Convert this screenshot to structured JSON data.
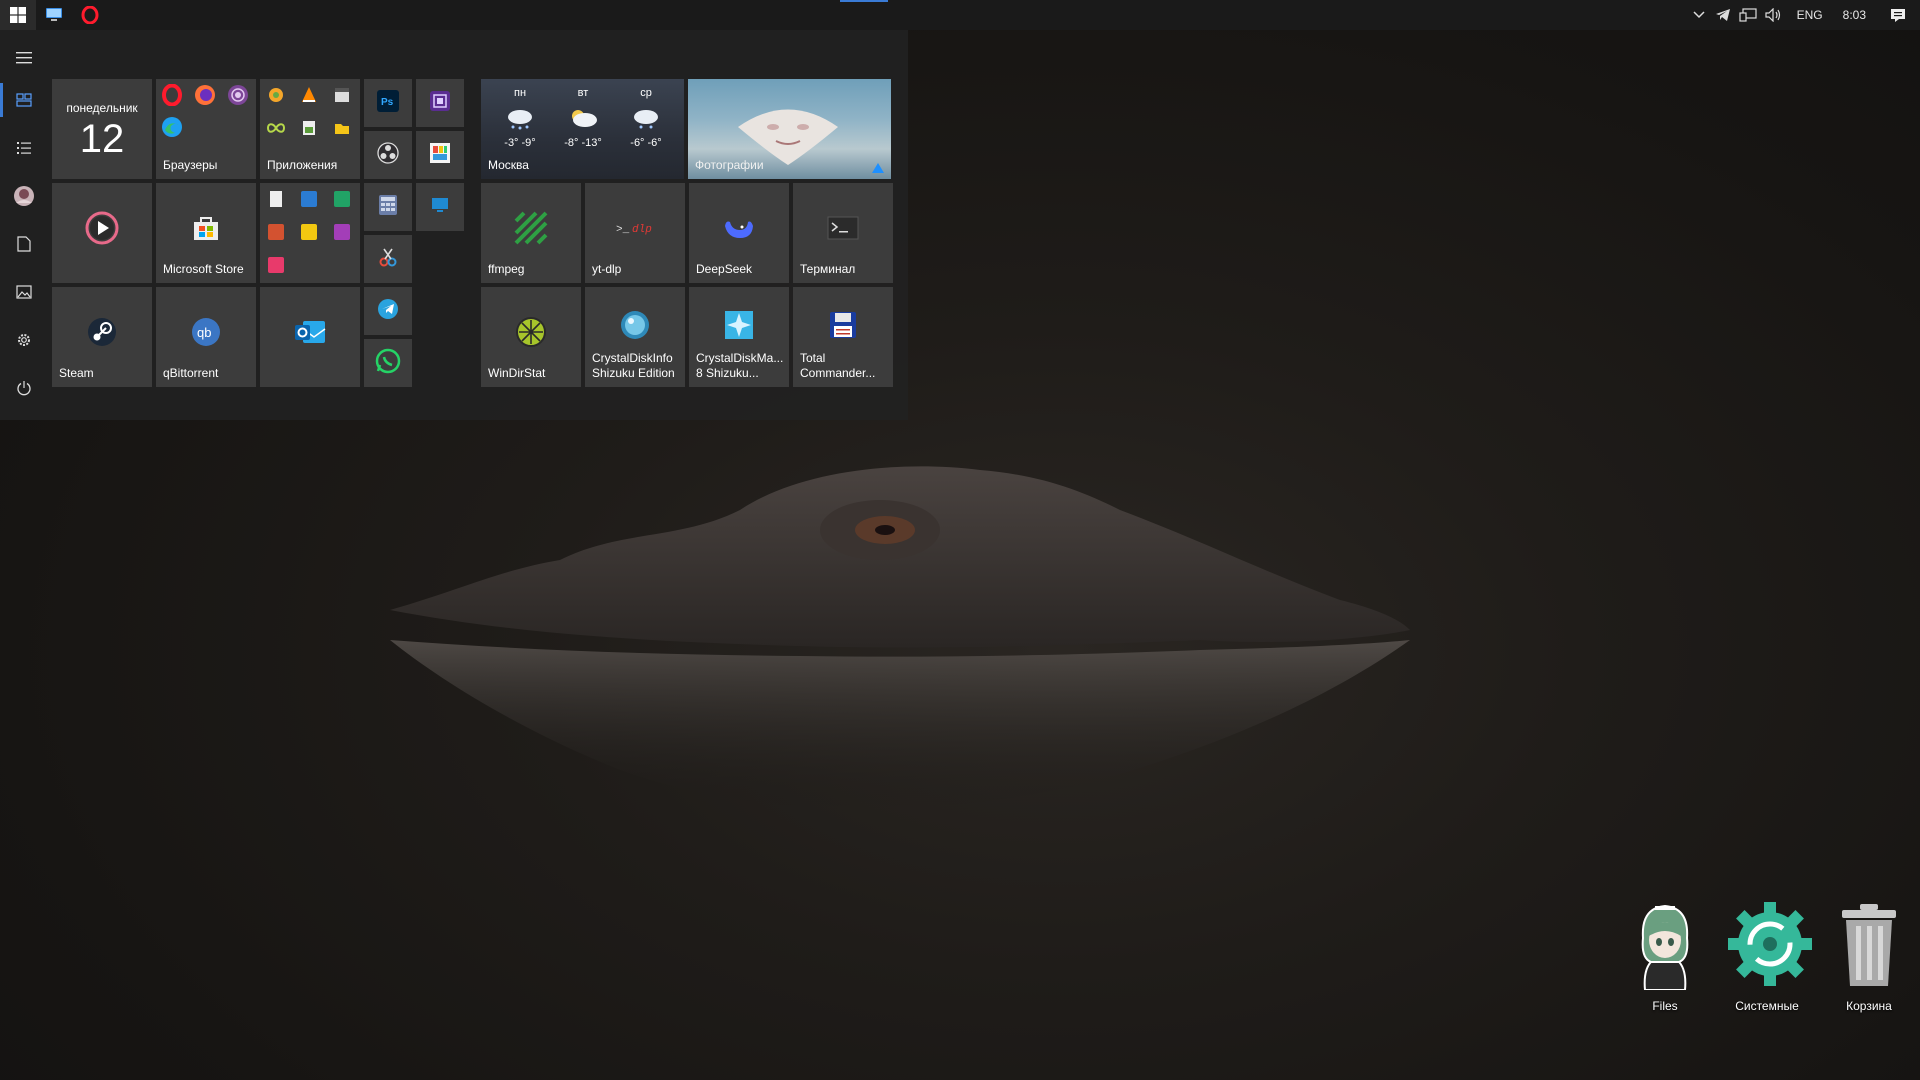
{
  "taskbar": {
    "pinned": [
      {
        "icon": "this-pc-icon"
      },
      {
        "icon": "opera-icon"
      }
    ],
    "tray": {
      "language": "ENG",
      "time": "8:03"
    }
  },
  "start_menu": {
    "rail": [
      "hamburger-icon",
      "tiles-icon",
      "list-icon",
      "user-avatar",
      "documents-icon",
      "pictures-icon",
      "settings-icon",
      "power-icon"
    ],
    "calendar": {
      "day": "понедельник",
      "number": "12"
    },
    "groups": {
      "browsers": {
        "label": "Браузеры"
      },
      "apps": {
        "label": "Приложения"
      }
    },
    "tiles": {
      "microsoft_store": "Microsoft Store",
      "steam": "Steam",
      "qbittorrent": "qBittorrent",
      "ffmpeg": "ffmpeg",
      "ytdlp": "yt-dlp",
      "deepseek": "DeepSeek",
      "terminal": "Терминал",
      "windirstat": "WinDirStat",
      "crystaldiskinfo_1": "CrystalDiskInfo",
      "crystaldiskinfo_2": "Shizuku Edition",
      "crystaldiskmark_1": "CrystalDiskMa...",
      "crystaldiskmark_2": "8 Shizuku...",
      "total_commander_1": "Total",
      "total_commander_2": "Commander..."
    },
    "weather": {
      "city": "Москва",
      "days": [
        {
          "day": "пн",
          "temp": "-3° -9°"
        },
        {
          "day": "вт",
          "temp": "-8° -13°"
        },
        {
          "day": "ср",
          "temp": "-6° -6°"
        }
      ]
    },
    "photos": {
      "label": "Фотографии"
    }
  },
  "desktop": {
    "icons": [
      {
        "label": "Files"
      },
      {
        "label": "Системные"
      },
      {
        "label": "Корзина"
      }
    ]
  },
  "colors": {
    "accent": "#3a7bd5",
    "tile": "#3c3c3c",
    "menu_bg": "#212121",
    "taskbar": "#1a1a1a"
  }
}
